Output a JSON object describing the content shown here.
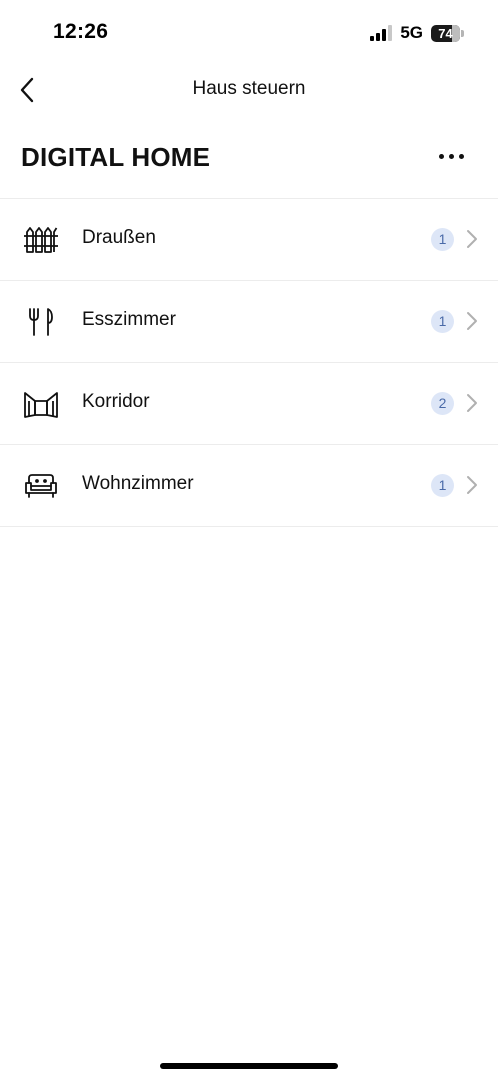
{
  "status_bar": {
    "time": "12:26",
    "network": "5G",
    "battery": "74",
    "battery_level_percent": 74
  },
  "nav": {
    "title": "Haus steuern",
    "back_icon": "chevron-left-icon"
  },
  "home": {
    "title": "DIGITAL HOME",
    "more_icon": "more-horizontal-icon"
  },
  "rooms": [
    {
      "name": "Draußen",
      "count": "1",
      "icon": "fence-icon"
    },
    {
      "name": "Esszimmer",
      "count": "1",
      "icon": "fork-knife-icon"
    },
    {
      "name": "Korridor",
      "count": "2",
      "icon": "corridor-icon"
    },
    {
      "name": "Wohnzimmer",
      "count": "1",
      "icon": "sofa-icon"
    }
  ],
  "colors": {
    "badge_background": "#dde6f7",
    "badge_text": "#4a6aa8",
    "chevron": "#b0b0b0",
    "divider": "#ececec"
  }
}
